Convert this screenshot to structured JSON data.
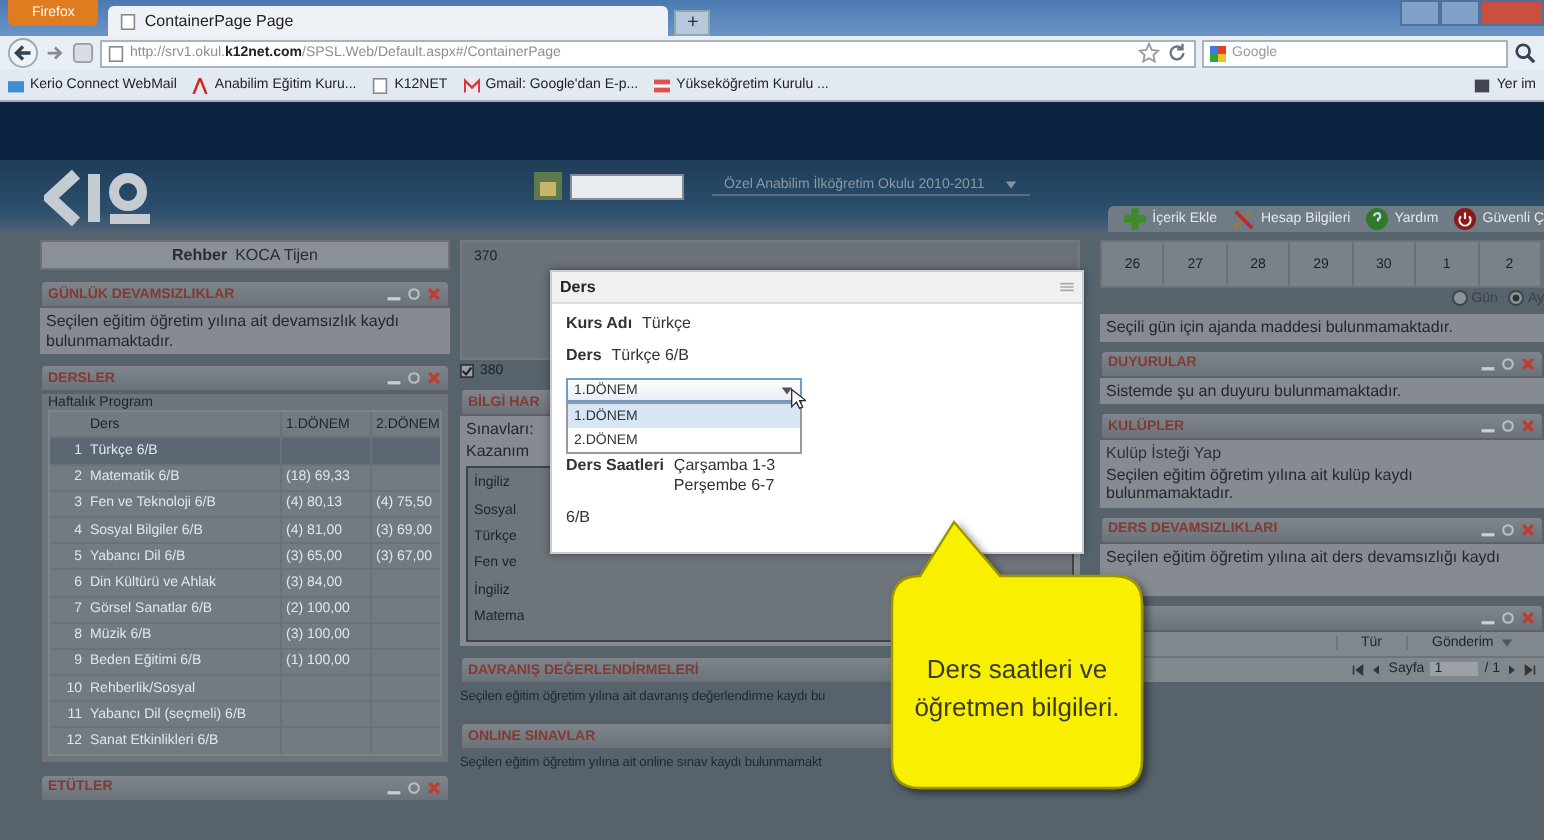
{
  "browser": {
    "firefox_button": "Firefox",
    "tabs": [
      {
        "label": "ContainerPage Page",
        "selected": true
      }
    ],
    "new_tab": "+",
    "url": "http://srv1.okul.**k12net.com**/SPSL.Web/Default.aspx#/ContainerPage",
    "search_placeholder": "Google",
    "bookmarks": [
      {
        "label": "Kerio Connect WebMail",
        "kind": "mail"
      },
      {
        "label": "Anabilim Eğitim Kuru...",
        "kind": "logo"
      },
      {
        "label": "K12NET",
        "kind": "page"
      },
      {
        "label": "Gmail: Google'dan E-p...",
        "kind": "gmail"
      },
      {
        "label": "Yükseköğretim Kurulu ...",
        "kind": "flag"
      }
    ],
    "bookmarks_menu": "Yer im"
  },
  "header": {
    "school": "Özel Anabilim İlköğretim Okulu  2010-2011",
    "toolbar": [
      {
        "label": "İçerik Ekle",
        "kind": "add"
      },
      {
        "label": "Hesap Bilgileri",
        "kind": "tools"
      },
      {
        "label": "Yardım",
        "kind": "help"
      },
      {
        "label": "Güvenli Ç",
        "kind": "power"
      }
    ]
  },
  "left": {
    "guide_label": "Rehber",
    "guide_name": "KOCA Tijen",
    "attendance": {
      "title": "GÜNLÜK DEVAMSIZLIKLAR",
      "message": "Seçilen eğitim öğretim yılına ait devamsızlık kaydı bulunmamaktadır."
    },
    "lessons": {
      "title": "DERSLER",
      "subtitle": "Haftalık Program",
      "columns": [
        "Ders",
        "1.DÖNEM",
        "2.DÖNEM"
      ],
      "rows": [
        {
          "no": "1",
          "name": "Türkçe 6/B",
          "selected": true
        },
        {
          "no": "2",
          "name": "Matematik 6/B",
          "term1": "(18)  69,33",
          "selected": false
        },
        {
          "no": "3",
          "name": "Fen ve Teknoloji 6/B",
          "term1": "(4)  80,13",
          "term2": "(4)  75,50",
          "selected": false
        },
        {
          "no": "4",
          "name": "Sosyal Bilgiler 6/B",
          "term1": "(4)  81,00",
          "term2": "(3)  69,00",
          "selected": false
        },
        {
          "no": "5",
          "name": "Yabancı Dil 6/B",
          "term1": "(3)  65,00",
          "term2": "(3)  67,00",
          "selected": false
        },
        {
          "no": "6",
          "name": "Din Kültürü ve Ahlak",
          "term1": "(3)  84,00",
          "selected": false
        },
        {
          "no": "7",
          "name": "Görsel Sanatlar 6/B",
          "term1": "(2)  100,00",
          "selected": false
        },
        {
          "no": "8",
          "name": "Müzik 6/B",
          "term1": "(3)  100,00",
          "selected": false
        },
        {
          "no": "9",
          "name": "Beden Eğitimi 6/B",
          "term1": "(1)  100,00",
          "selected": false
        },
        {
          "no": "10",
          "name": "Rehberlik/Sosyal",
          "selected": false
        },
        {
          "no": "11",
          "name": "Yabancı Dil (seçmeli) 6/B",
          "selected": false
        },
        {
          "no": "12",
          "name": "Sanat Etkinlikleri 6/B",
          "selected": false
        }
      ]
    },
    "study": {
      "title": "ETÜTLER"
    }
  },
  "middle": {
    "chart_tick": "370",
    "legend_label": "380",
    "legend_checked": true,
    "info": {
      "title": "BİLGİ HAR",
      "exams_label": "Sınavları:",
      "outcome_label": "Kazanım",
      "items": [
        "İngiliz",
        "Sosyal",
        "Türkçe",
        "Fen ve",
        "İngiliz",
        "Matema"
      ]
    },
    "behavior": {
      "title": "DAVRANIŞ DEĞERLENDİRMELERİ",
      "message": "Seçilen eğitim öğretim yılına ait davranış değerlendirme kaydı bu"
    },
    "online": {
      "title": "ONLINE SINAVLAR",
      "message": "Seçilen eğitim öğretim yılına ait online sınav kaydı bulunmamakt"
    }
  },
  "right": {
    "calendar_days": [
      "26",
      "27",
      "28",
      "29",
      "30",
      "1",
      "2"
    ],
    "view_options": [
      {
        "label": "Gün",
        "selected": false
      },
      {
        "label": "Ay",
        "selected": true
      }
    ],
    "agenda_message": "Seçili gün için ajanda maddesi bulunmamaktadır.",
    "announcements": {
      "title": "DUYURULAR",
      "message": "Sistemde şu an duyuru bulunmamaktadır."
    },
    "clubs": {
      "title": "KULÜPLER",
      "link": "Kulüp İsteği Yap",
      "message": "Seçilen eğitim öğretim yılına ait kulüp kaydı bulunmamaktadır."
    },
    "course_absence": {
      "title": "DERS DEVAMSIZLIKLARI",
      "message": "Seçilen eğitim öğretim yılına ait ders devamsızlığı kaydı"
    },
    "messages": {
      "columns": [
        "Tür",
        "Gönderim"
      ],
      "pager_label": "Sayfa",
      "page": "1",
      "page_total": "/ 1"
    }
  },
  "modal": {
    "title": "Ders",
    "course_label": "Kurs Adı",
    "course": "Türkçe",
    "lesson_label": "Ders",
    "lesson": "Türkçe 6/B",
    "term_select": "1.DÖNEM",
    "term_options": [
      {
        "label": "1.DÖNEM",
        "selected": true
      },
      {
        "label": "2.DÖNEM",
        "selected": false
      }
    ],
    "hours_label": "Ders Saatleri",
    "hours": [
      "Çarşamba 1-3",
      "Perşembe 6-7"
    ],
    "class": "6/B"
  },
  "callout": {
    "text": "Ders saatleri ve öğretmen bilgileri."
  }
}
